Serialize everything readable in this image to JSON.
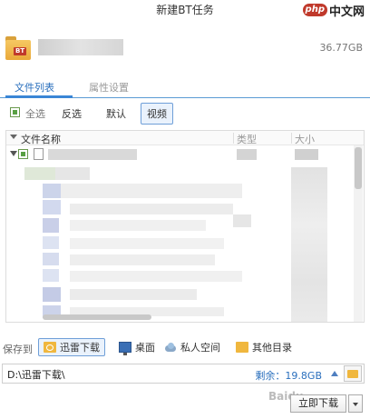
{
  "window": {
    "title": "新建BT任务"
  },
  "watermark": {
    "badge": "php",
    "text": "中文网",
    "bottom_text": "Baidu"
  },
  "task": {
    "total_size": "36.77GB",
    "badge": "BT"
  },
  "tabs": [
    {
      "label": "文件列表",
      "active": true
    },
    {
      "label": "属性设置",
      "active": false
    }
  ],
  "filters": {
    "select_all": "全选",
    "invert": "反选",
    "default": "默认",
    "video": "视频"
  },
  "file_list": {
    "columns": {
      "name": "文件名称",
      "type": "类型",
      "size": "大小"
    }
  },
  "save_to": {
    "label": "保存到",
    "options": [
      {
        "label": "迅雷下载",
        "icon": "folder-icon",
        "selected": true
      },
      {
        "label": "桌面",
        "icon": "desktop-icon",
        "selected": false
      },
      {
        "label": "私人空间",
        "icon": "cloud-icon",
        "selected": false
      },
      {
        "label": "其他目录",
        "icon": "folder-icon",
        "selected": false
      }
    ]
  },
  "path": {
    "value": "D:\\迅雷下载\\",
    "remaining": "剩余：19.8GB"
  },
  "actions": {
    "download": "立即下载"
  }
}
